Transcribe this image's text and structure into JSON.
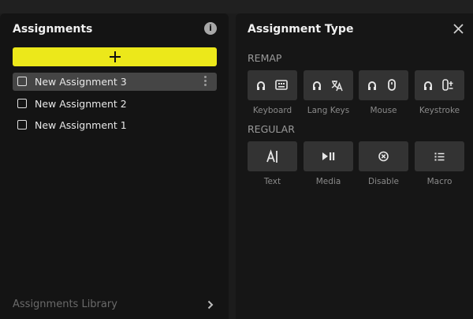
{
  "left_panel": {
    "title": "Assignments",
    "add_button_label": "+",
    "items": [
      {
        "label": "New Assignment 3",
        "selected": true
      },
      {
        "label": "New Assignment 2",
        "selected": false
      },
      {
        "label": "New Assignment 1",
        "selected": false
      }
    ],
    "library_label": "Assignments Library"
  },
  "right_panel": {
    "title": "Assignment Type",
    "sections": [
      {
        "label": "REMAP",
        "tiles": [
          {
            "label": "Keyboard",
            "icon": "keyboard-icon"
          },
          {
            "label": "Lang Keys",
            "icon": "language-icon"
          },
          {
            "label": "Mouse",
            "icon": "mouse-icon"
          },
          {
            "label": "Keystroke",
            "icon": "keystroke-icon"
          }
        ]
      },
      {
        "label": "REGULAR",
        "tiles": [
          {
            "label": "Text",
            "icon": "text-cursor-icon"
          },
          {
            "label": "Media",
            "icon": "play-pause-icon"
          },
          {
            "label": "Disable",
            "icon": "disable-icon"
          },
          {
            "label": "Macro",
            "icon": "list-icon"
          }
        ]
      }
    ]
  },
  "colors": {
    "accent": "#ece81a",
    "panel_bg": "#141414",
    "tile_bg": "#333333"
  }
}
